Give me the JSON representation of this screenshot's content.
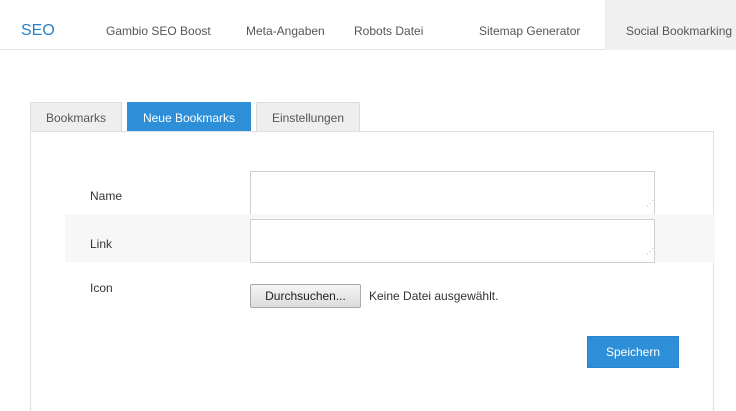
{
  "topnav": {
    "brand": "SEO",
    "items": [
      "Gambio SEO Boost",
      "Meta-Angaben",
      "Robots Datei",
      "Sitemap Generator",
      "Social Bookmarking"
    ]
  },
  "tabs": [
    {
      "label": "Bookmarks",
      "active": false
    },
    {
      "label": "Neue Bookmarks",
      "active": true
    },
    {
      "label": "Einstellungen",
      "active": false
    }
  ],
  "form": {
    "name_label": "Name",
    "name_value": "",
    "link_label": "Link",
    "link_value": "",
    "icon_label": "Icon",
    "file_button": "Durchsuchen...",
    "file_status": "Keine Datei ausgewählt.",
    "save_label": "Speichern"
  },
  "colors": {
    "accent": "#2d8fd8",
    "brand": "#2a7fc7"
  }
}
